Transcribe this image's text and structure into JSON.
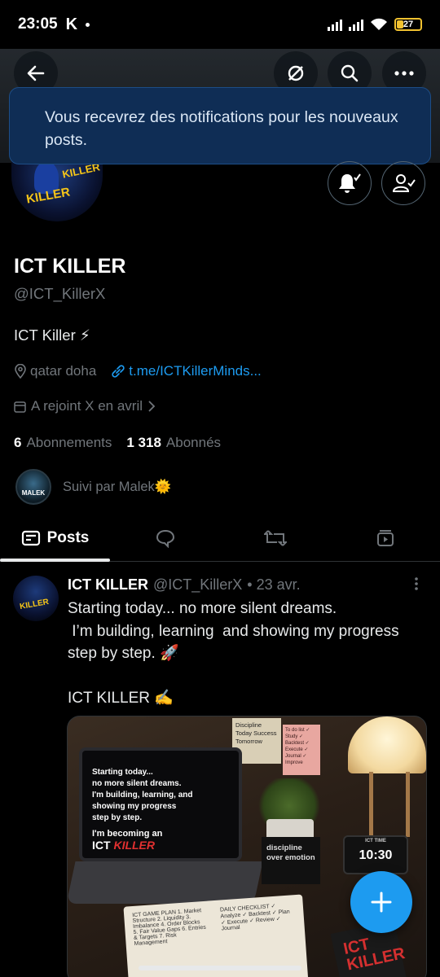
{
  "status_bar": {
    "time": "23:05",
    "app_letter": "K",
    "battery": "27"
  },
  "toast": {
    "message": "Vous recevrez des notifications pour les nouveaux posts."
  },
  "profile": {
    "display_name": "ICT KILLER",
    "handle": "@ICT_KillerX",
    "bio": "ICT Killer ⚡",
    "location": "qatar doha",
    "link": "t.me/ICTKillerMinds...",
    "joined": "A rejoint X en avril",
    "following_count": "6",
    "following_label": "Abonnements",
    "followers_count": "1 318",
    "followers_label": "Abonnés",
    "followed_by": "Suivi par Malek🌞",
    "followed_avatar_text": "MALEK",
    "avatar_logo_text": "KILLER"
  },
  "tabs": {
    "posts_label": "Posts"
  },
  "post": {
    "name": "ICT KILLER",
    "handle": "@ICT_KillerX",
    "date": "• 23 avr.",
    "text": "Starting today... no more silent dreams.\n I’m building, learning  and showing my progress step by step. 🚀\n\nICT KILLER ✍️",
    "media": {
      "screen_line1": "Starting today...",
      "screen_line2": "no more silent dreams.",
      "screen_line3": "I'm building, learning, and",
      "screen_line4": "showing my progress",
      "screen_line5": "step by step.",
      "screen_line6": "I'm becoming an",
      "screen_brand_a": "ICT",
      "screen_brand_b": "KILLER",
      "note1": "Discipline Today Success Tomorrow",
      "note2": "To do list ✓ Study ✓ Backtest ✓ Execute ✓ Journal ✓ Improve",
      "sign": "discipline over emotion",
      "clock_label": "ICT TIME",
      "clock_value": "10:30",
      "notebook_left": "ICT GAME PLAN 1. Market Structure 2. Liquidity 3. Imbalance 4. Order Blocks 5. Fair Value Gaps 6. Entries & Targets 7. Risk Management",
      "notebook_right": "DAILY CHECKLIST ✓ Analyze ✓ Backtest ✓ Plan ✓ Execute ✓ Review ✓ Journal",
      "book_text": "ICT KILLER"
    }
  },
  "colors": {
    "accent": "#1d9bf0",
    "toast_bg": "#0f2d55",
    "muted": "#71767b",
    "background": "#000000"
  },
  "icons": [
    "back-arrow-icon",
    "refresh-icon",
    "search-icon",
    "more-icon",
    "bell-check-icon",
    "person-check-icon",
    "location-icon",
    "link-icon",
    "calendar-icon",
    "chevron-right-icon",
    "posts-tab-icon",
    "replies-icon",
    "retweet-icon",
    "media-icon",
    "kebab-icon",
    "plus-icon"
  ]
}
